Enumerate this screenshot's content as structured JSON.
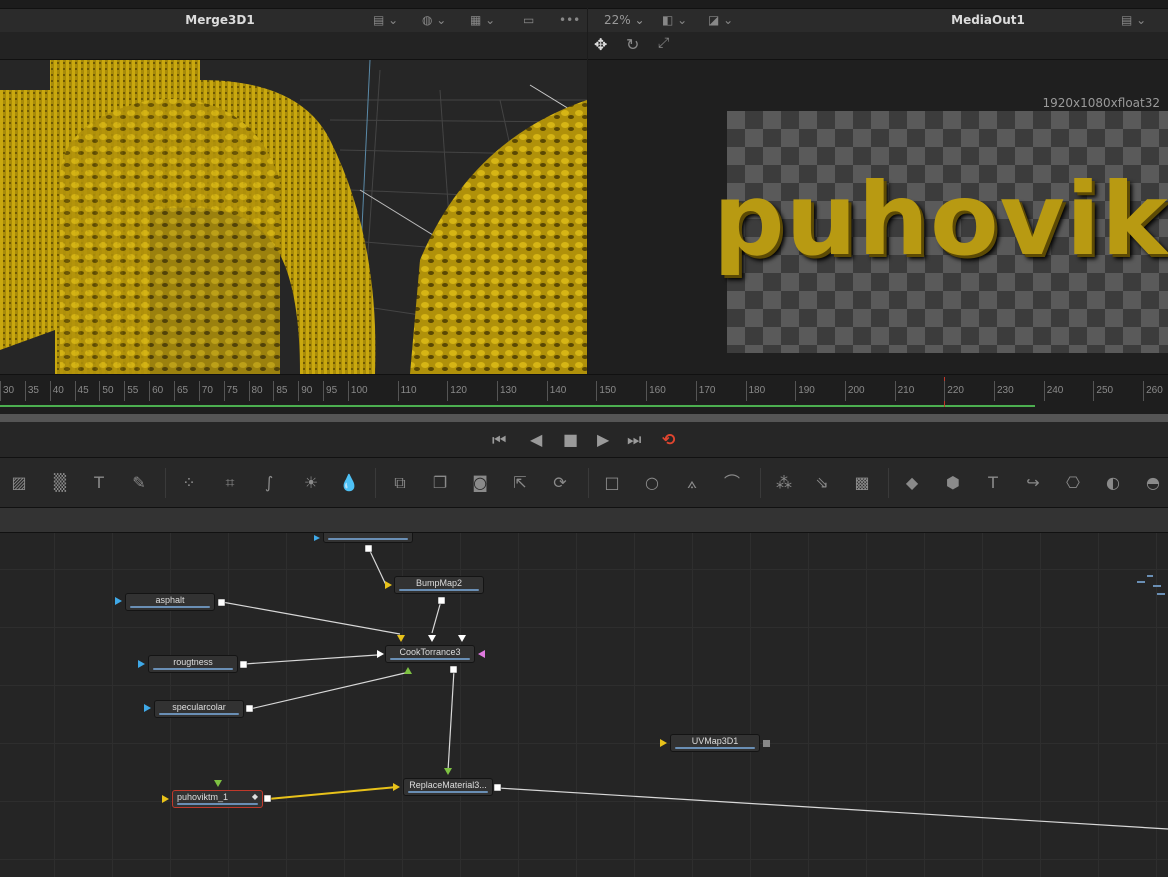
{
  "viewer_left": {
    "title": "Merge3D1",
    "more": "•••"
  },
  "viewer_right": {
    "zoom": "22%",
    "title": "MediaOut1",
    "resolution": "1920x1080xfloat32",
    "render_text": "puhovikt"
  },
  "timeline": {
    "labels": [
      "30",
      "35",
      "40",
      "45",
      "50",
      "55",
      "60",
      "65",
      "70",
      "75",
      "80",
      "85",
      "90",
      "95",
      "100",
      "110",
      "120",
      "130",
      "140",
      "150",
      "160",
      "170",
      "180",
      "190",
      "200",
      "210",
      "220",
      "230",
      "240",
      "250",
      "260"
    ],
    "current_frame": 220,
    "playhead_color": "#c0392b",
    "render_range_color": "#4caf50"
  },
  "transport": {
    "buttons": [
      "skip-to-start",
      "step-back",
      "stop",
      "play",
      "skip-to-end",
      "loop"
    ],
    "loop_color": "#e0452f"
  },
  "toolbar": {
    "tools": [
      "background",
      "fast-noise",
      "text",
      "paint",
      "particle",
      "color-curves",
      "color-correct",
      "brightness",
      "blur",
      "merge",
      "channel-boolean",
      "matte-control",
      "transform",
      "resize",
      "rectangle-mask",
      "ellipse-mask",
      "polygon-mask",
      "bspline-mask",
      "particle-emitter",
      "particle-render",
      "particle-kill",
      "shape3d",
      "merge3d",
      "text3d",
      "renderer3d",
      "camera3d",
      "light3d",
      "image-plane3d"
    ]
  },
  "nodes": [
    {
      "label": "",
      "id": "top"
    },
    {
      "label": "BumpMap2"
    },
    {
      "label": "asphalt"
    },
    {
      "label": "CookTorrance3"
    },
    {
      "label": "rougtness"
    },
    {
      "label": "specularcolar"
    },
    {
      "label": "UVMap3D1"
    },
    {
      "label": "puhoviktm_1"
    },
    {
      "label": "ReplaceMaterial3..."
    }
  ]
}
